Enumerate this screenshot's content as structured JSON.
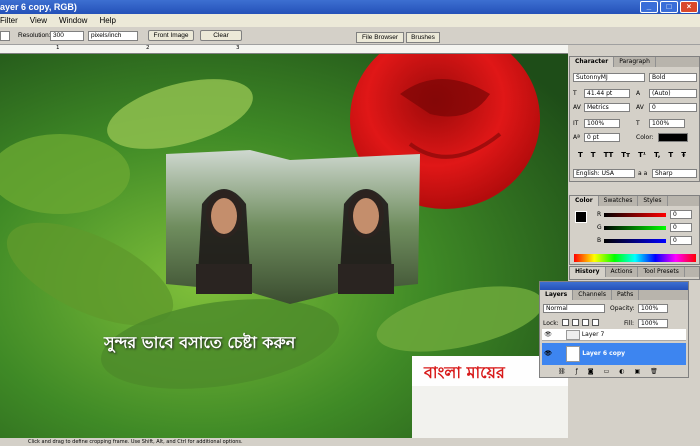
{
  "window": {
    "title": "ayer 6 copy, RGB)"
  },
  "menu": [
    "Filter",
    "View",
    "Window",
    "Help"
  ],
  "options": {
    "resolution_label": "Resolution:",
    "resolution_value": "300",
    "unit": "pixels/inch",
    "front_image": "Front Image",
    "clear": "Clear"
  },
  "palette_well": {
    "file_browser": "File Browser",
    "brushes": "Brushes"
  },
  "ruler": {
    "marks": [
      "1",
      "2",
      "3"
    ]
  },
  "canvas": {
    "caption": "সুন্দর ভাবে বসাতে চেষ্টা করুন",
    "banner_text": "বাংলা মায়ের"
  },
  "status": {
    "text": "Click and drag to define cropping frame. Use Shift, Alt, and Ctrl for additional options."
  },
  "character": {
    "tabs": [
      "Character",
      "Paragraph"
    ],
    "font": "SutonnyMJ",
    "style": "Bold",
    "size": "41.44 pt",
    "leading": "(Auto)",
    "kerning": "Metrics",
    "tracking": "0",
    "vscale": "100%",
    "hscale": "100%",
    "baseline": "0 pt",
    "color_label": "Color:",
    "styles": [
      "T",
      "T",
      "TT",
      "Tт",
      "T¹",
      "T,",
      "T",
      "Ŧ"
    ],
    "language": "English: USA",
    "aa_label": "a a",
    "aa": "Sharp"
  },
  "color_panel": {
    "tabs": [
      "Color",
      "Swatches",
      "Styles"
    ],
    "r_label": "R",
    "g_label": "G",
    "b_label": "B",
    "r": "0",
    "g": "0",
    "b": "0"
  },
  "history": {
    "tabs": [
      "History",
      "Actions",
      "Tool Presets"
    ]
  },
  "layers": {
    "tabs": [
      "Layers",
      "Channels",
      "Paths"
    ],
    "mode": "Normal",
    "opacity_label": "Opacity:",
    "opacity": "100%",
    "lock_label": "Lock:",
    "fill_label": "Fill:",
    "fill": "100%",
    "items": [
      {
        "name": "Layer 7",
        "selected": false
      },
      {
        "name": "Layer 6 copy",
        "selected": true
      }
    ]
  }
}
